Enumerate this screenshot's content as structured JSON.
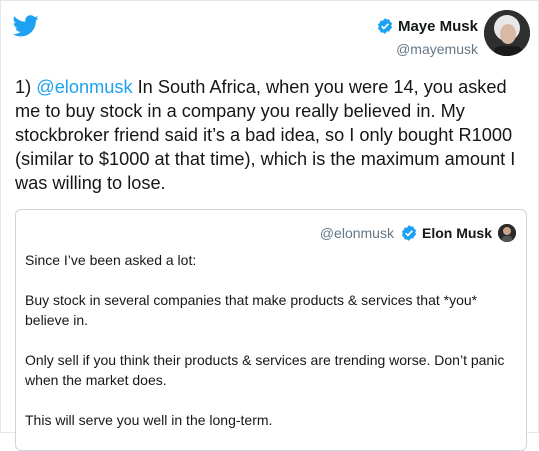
{
  "author": {
    "name": "Maye Musk",
    "handle": "@mayemusk"
  },
  "tweet": {
    "number": "1)",
    "mention": "@elonmusk",
    "text": " In South Africa, when you were 14, you asked me to buy stock in a company you really believed in. My stockbroker friend said it’s a bad idea, so I only bought R1000 (similar to $1000 at that time), which is the maximum amount I was willing to lose."
  },
  "quoted": {
    "handle": "@elonmusk",
    "name": "Elon Musk",
    "paragraphs": [
      "Since I’ve been asked a lot:",
      "Buy stock in several companies that make products & services that *you* believe in.",
      "Only sell if you think their products & services are trending worse. Don’t panic when the market does.",
      "This will serve you well in the long-term."
    ]
  },
  "colors": {
    "brand": "#1da1f2",
    "handle": "#657786",
    "border": "#ccd6dd"
  },
  "icons": {
    "logo": "twitter-bird-icon",
    "verified": "verified-badge-icon"
  }
}
